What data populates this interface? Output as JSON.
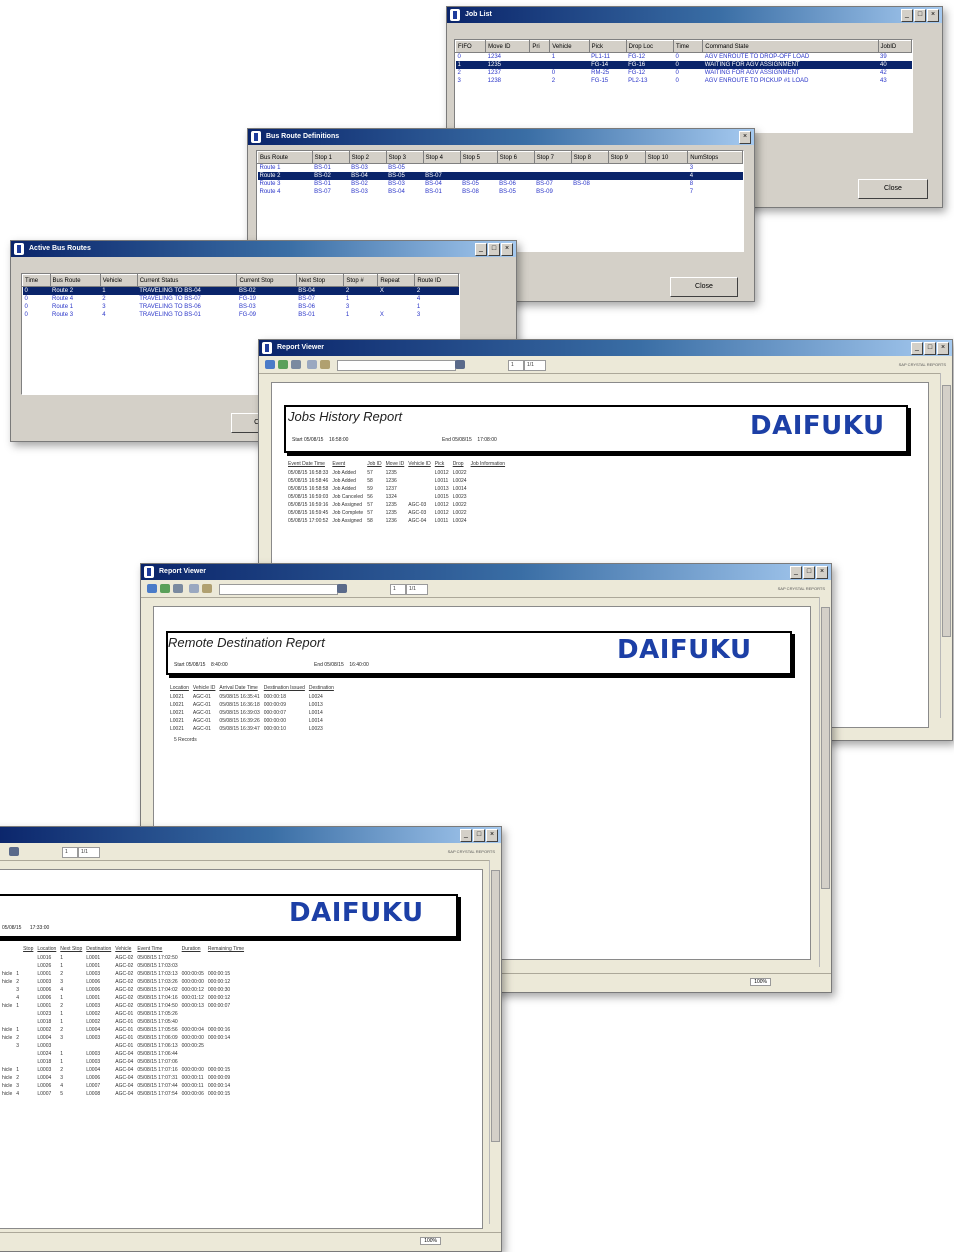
{
  "job_list": {
    "title": "Job List",
    "columns": [
      "FIFO",
      "Move ID",
      "Pri",
      "Vehicle",
      "Pick",
      "Drop Loc",
      "Time",
      "Command State",
      "JobID"
    ],
    "rows": [
      [
        "0",
        "1234",
        "",
        "1",
        "PL1-11",
        "FG-12",
        "0",
        "AGV ENROUTE TO DROP-OFF LOAD",
        "39"
      ],
      [
        "1",
        "1235",
        "",
        "",
        "FG-14",
        "FG-16",
        "0",
        "WAITING FOR AGV ASSIGNMENT",
        "40"
      ],
      [
        "2",
        "1237",
        "",
        "0",
        "RM-25",
        "FG-12",
        "0",
        "WAITING FOR AGV ASSIGNMENT",
        "42"
      ],
      [
        "3",
        "1238",
        "",
        "2",
        "FG-15",
        "PL2-13",
        "0",
        "AGV ENROUTE TO PICKUP #1 LOAD",
        "43"
      ]
    ],
    "close_label": "Close"
  },
  "bus_routes": {
    "title": "Bus Route Definitions",
    "columns": [
      "Bus Route",
      "Stop 1",
      "Stop 2",
      "Stop 3",
      "Stop 4",
      "Stop 5",
      "Stop 6",
      "Stop 7",
      "Stop 8",
      "Stop 9",
      "Stop 10",
      "NumStops"
    ],
    "rows": [
      [
        "Route 1",
        "BS-01",
        "BS-03",
        "BS-05",
        "",
        "",
        "",
        "",
        "",
        "",
        "",
        "3"
      ],
      [
        "Route 2",
        "BS-02",
        "BS-04",
        "BS-05",
        "BS-07",
        "",
        "",
        "",
        "",
        "",
        "",
        "4"
      ],
      [
        "Route 3",
        "BS-01",
        "BS-02",
        "BS-03",
        "BS-04",
        "BS-05",
        "BS-06",
        "BS-07",
        "BS-08",
        "",
        "",
        "8"
      ],
      [
        "Route 4",
        "BS-07",
        "BS-03",
        "BS-04",
        "BS-01",
        "BS-08",
        "BS-05",
        "BS-09",
        "",
        "",
        "",
        "7"
      ]
    ],
    "close_label": "Close"
  },
  "active_routes": {
    "title": "Active Bus Routes",
    "columns": [
      "Time",
      "Bus Route",
      "Vehicle",
      "Current Status",
      "Current Stop",
      "Next Stop",
      "Stop #",
      "Repeat",
      "Route ID"
    ],
    "rows": [
      [
        "0",
        "Route 2",
        "1",
        "TRAVELING TO BS-04",
        "BS-02",
        "BS-04",
        "2",
        "X",
        "2"
      ],
      [
        "0",
        "Route 4",
        "2",
        "TRAVELING TO BS-07",
        "FG-19",
        "BS-07",
        "1",
        "",
        "4"
      ],
      [
        "0",
        "Route 1",
        "3",
        "TRAVELING TO BS-06",
        "BS-03",
        "BS-06",
        "3",
        "",
        "1"
      ],
      [
        "0",
        "Route 3",
        "4",
        "TRAVELING TO BS-01",
        "FG-09",
        "BS-01",
        "1",
        "X",
        "3"
      ]
    ],
    "cancel_label": "Cancel"
  },
  "viewer_common": {
    "window_title": "Report Viewer",
    "brand": "SAP CRYSTAL REPORTS",
    "page": "1",
    "page_total": "1/1",
    "zoom": "100%",
    "logo": "DAIFUKU"
  },
  "jobs_history": {
    "title": "Jobs History Report",
    "start_label": "Start 05/08/15",
    "start_time": "16:58:00",
    "end_label": "End 05/08/15",
    "end_time": "17:08:00",
    "columns": [
      "Event Date Time",
      "Event",
      "Job ID",
      "Move ID",
      "Vehicle ID",
      "Pick",
      "Drop",
      "Job Information"
    ],
    "rows": [
      [
        "05/08/15 16:58:33",
        "Job Added",
        "57",
        "1235",
        "",
        "L0012",
        "L0022",
        ""
      ],
      [
        "05/08/15 16:58:46",
        "Job Added",
        "58",
        "1236",
        "",
        "L0011",
        "L0024",
        ""
      ],
      [
        "05/08/15 16:58:58",
        "Job Added",
        "59",
        "1237",
        "",
        "L0013",
        "L0014",
        ""
      ],
      [
        "05/08/15 16:59:03",
        "Job Canceled",
        "56",
        "1324",
        "",
        "L0015",
        "L0023",
        ""
      ],
      [
        "05/08/15 16:59:16",
        "Job Assigned",
        "57",
        "1235",
        "AGC-03",
        "L0012",
        "L0022",
        ""
      ],
      [
        "05/08/15 16:59:45",
        "Job Complete",
        "57",
        "1235",
        "AGC-03",
        "L0012",
        "L0022",
        ""
      ],
      [
        "05/08/15 17:00:52",
        "Job Assigned",
        "58",
        "1236",
        "AGC-04",
        "L0011",
        "L0024",
        ""
      ]
    ]
  },
  "remote_dest": {
    "title": "Remote Destination Report",
    "start_label": "Start 05/08/15",
    "start_time": "8:40:00",
    "end_label": "End 05/08/15",
    "end_time": "16:40:00",
    "columns": [
      "Location",
      "Vehicle ID",
      "Arrival Date Time",
      "Destination Issued",
      "Destination"
    ],
    "rows": [
      [
        "L0021",
        "AGC-01",
        "05/08/15 16:35:41",
        "000:00:18",
        "L0024"
      ],
      [
        "L0021",
        "AGC-01",
        "05/08/15 16:36:18",
        "000:00:09",
        "L0013"
      ],
      [
        "L0021",
        "AGC-01",
        "05/08/15 16:39:03",
        "000:00:07",
        "L0014"
      ],
      [
        "L0021",
        "AGC-01",
        "05/08/15 16:39:26",
        "000:00:00",
        "L0014"
      ],
      [
        "L0021",
        "AGC-01",
        "05/08/15 16:39:47",
        "000:00:10",
        "L0023"
      ]
    ],
    "records_label": "5 Records"
  },
  "bus_route_report": {
    "header_date": "05/08/15",
    "header_time": "17:33:00",
    "columns": [
      "Stop",
      "Location",
      "Next Stop",
      "Destination",
      "Vehicle",
      "Event Time",
      "Duration",
      "Remaining Time"
    ],
    "rows": [
      [
        "",
        "",
        "",
        "L0016",
        "1",
        "L0001",
        "AGC-02",
        "05/08/15 17:02:50",
        "",
        ""
      ],
      [
        "",
        "",
        "",
        "L0026",
        "1",
        "L0001",
        "AGC-02",
        "05/08/15 17:03:03",
        "",
        ""
      ],
      [
        "hicle",
        "1",
        "",
        "L0001",
        "2",
        "L0003",
        "AGC-02",
        "05/08/15 17:03:13",
        "000:00:05",
        "000:00:15"
      ],
      [
        "hicle",
        "2",
        "",
        "L0003",
        "3",
        "L0006",
        "AGC-02",
        "05/08/15 17:03:26",
        "000:00:00",
        "000:00:12"
      ],
      [
        "",
        "3",
        "",
        "L0006",
        "4",
        "L0006",
        "AGC-02",
        "05/08/15 17:04:02",
        "000:00:12",
        "000:00:30"
      ],
      [
        "",
        "4",
        "",
        "L0006",
        "1",
        "L0001",
        "AGC-02",
        "05/08/15 17:04:16",
        "000:01:12",
        "000:00:12"
      ],
      [
        "hicle",
        "1",
        "",
        "L0001",
        "2",
        "L0003",
        "AGC-02",
        "05/08/15 17:04:50",
        "000:00:13",
        "000:00:07"
      ],
      [
        "",
        "",
        "",
        "L0023",
        "1",
        "L0002",
        "AGC-01",
        "05/08/15 17:05:26",
        "",
        ""
      ],
      [
        "",
        "",
        "",
        "L0018",
        "1",
        "L0002",
        "AGC-01",
        "05/08/15 17:05:40",
        "",
        ""
      ],
      [
        "hicle",
        "1",
        "",
        "L0002",
        "2",
        "L0004",
        "AGC-01",
        "05/08/15 17:05:56",
        "000:00:04",
        "000:00:16"
      ],
      [
        "hicle",
        "2",
        "",
        "L0004",
        "3",
        "L0003",
        "AGC-01",
        "05/08/15 17:06:09",
        "000:00:00",
        "000:00:14"
      ],
      [
        "",
        "3",
        "",
        "L0003",
        "",
        "",
        "AGC-01",
        "05/08/15 17:06:13",
        "000:00:25",
        ""
      ],
      [
        "",
        "",
        "",
        "L0024",
        "1",
        "L0003",
        "AGC-04",
        "05/08/15 17:06:44",
        "",
        ""
      ],
      [
        "",
        "",
        "",
        "L0018",
        "1",
        "L0003",
        "AGC-04",
        "05/08/15 17:07:06",
        "",
        ""
      ],
      [
        "hicle",
        "1",
        "",
        "L0003",
        "2",
        "L0004",
        "AGC-04",
        "05/08/15 17:07:16",
        "000:00:00",
        "000:00:15"
      ],
      [
        "hicle",
        "2",
        "",
        "L0004",
        "3",
        "L0006",
        "AGC-04",
        "05/08/15 17:07:31",
        "000:00:11",
        "000:00:09"
      ],
      [
        "hicle",
        "3",
        "",
        "L0006",
        "4",
        "L0007",
        "AGC-04",
        "05/08/15 17:07:44",
        "000:00:11",
        "000:00:14"
      ],
      [
        "hicle",
        "4",
        "",
        "L0007",
        "5",
        "L0008",
        "AGC-04",
        "05/08/15 17:07:54",
        "000:00:06",
        "000:00:15"
      ]
    ]
  },
  "colors": {
    "selection": "#0a246a",
    "grid_text": "#2a35c8",
    "logo": "#1c3fa6"
  }
}
